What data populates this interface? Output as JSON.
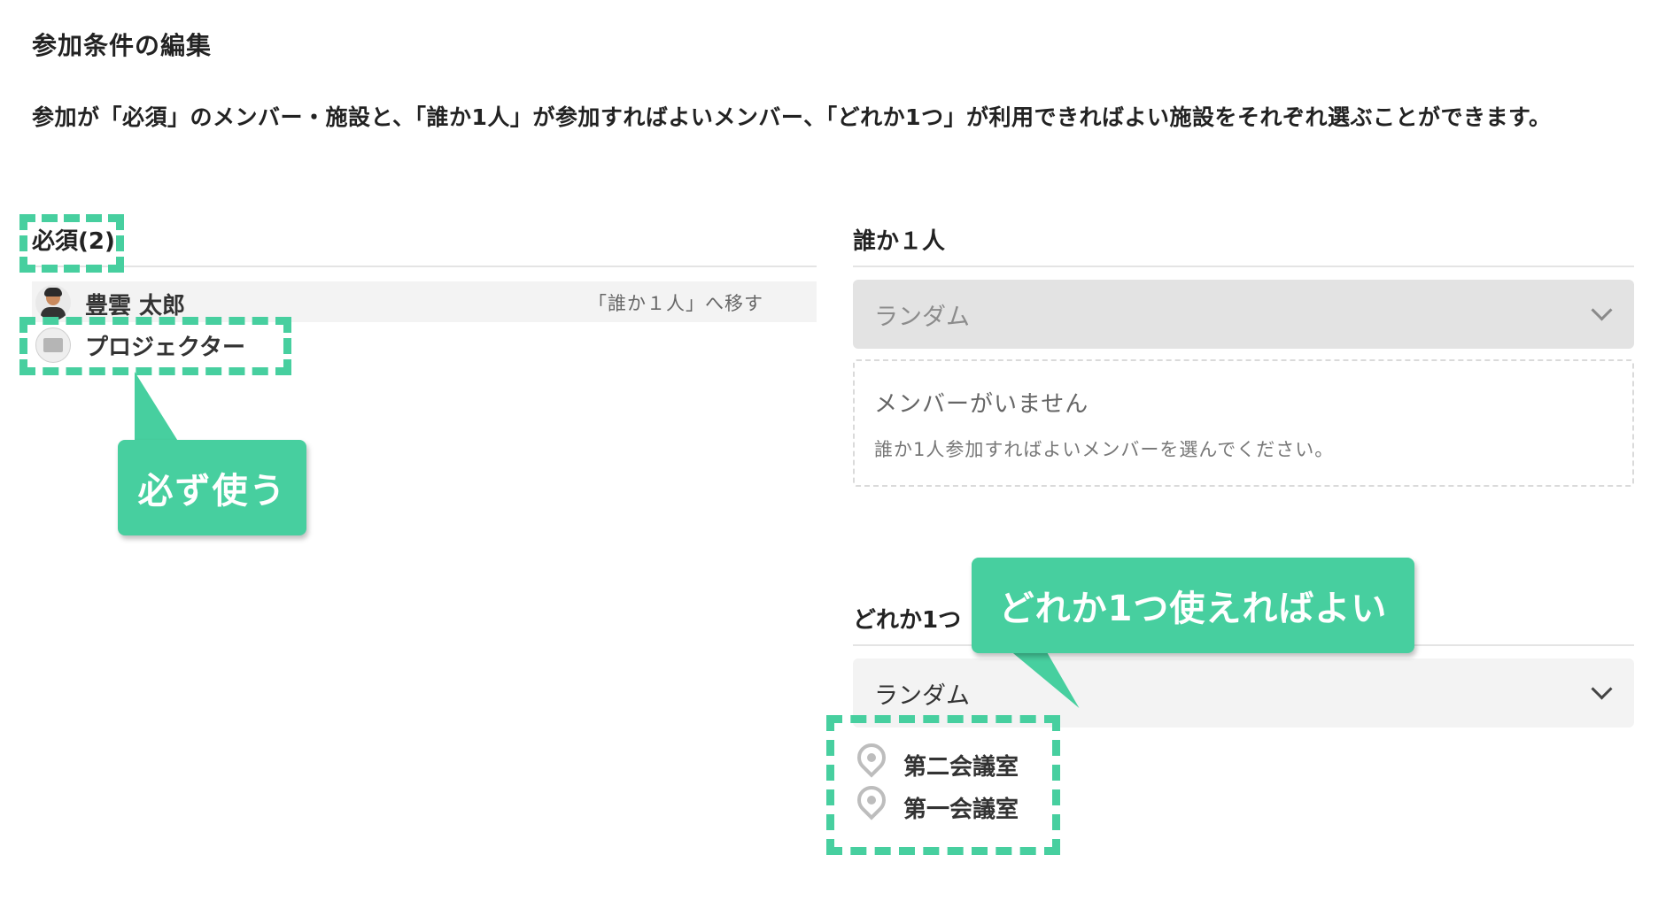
{
  "page_title": "参加条件の編集",
  "description": "参加が「必須」のメンバー・施設と、「誰か1人」が参加すればよいメンバー、「どれか1つ」が利用できればよい施設をそれぞれ選ぶことができます。",
  "required": {
    "header": "必須(2)",
    "member": {
      "name": "豊雲 太郎",
      "action": "「誰か１人」へ移す"
    },
    "facility": {
      "name": "プロジェクター"
    }
  },
  "anyone": {
    "header": "誰か１人",
    "select_value": "ランダム",
    "empty_title": "メンバーがいません",
    "empty_hint": "誰か1人参加すればよいメンバーを選んでください。"
  },
  "any_facility": {
    "header": "どれか1つ",
    "select_value": "ランダム",
    "rooms": [
      "第二会議室",
      "第一会議室"
    ]
  },
  "callouts": {
    "must_use": "必ず使う",
    "any_one_ok": "どれか1つ使えればよい"
  },
  "colors": {
    "accent": "#47cf9f"
  }
}
